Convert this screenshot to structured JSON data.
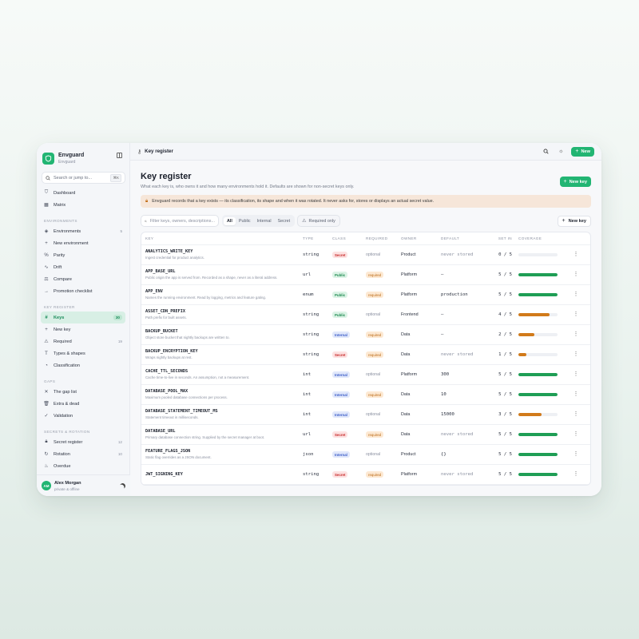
{
  "brand": {
    "name": "Envguard",
    "sub": "Envguard"
  },
  "search": {
    "placeholder": "Search or jump to...",
    "shortcut": "⌘K"
  },
  "sidebar": {
    "groups": [
      {
        "title": "",
        "items": [
          {
            "label": "Dashboard",
            "icon": "shield-icon"
          },
          {
            "label": "Matrix",
            "icon": "grid-icon"
          }
        ]
      },
      {
        "title": "ENVIRONMENTS",
        "items": [
          {
            "label": "Environments",
            "icon": "layers-icon",
            "count": "5"
          },
          {
            "label": "New environment",
            "icon": "plus-icon"
          },
          {
            "label": "Parity",
            "icon": "percent-icon"
          },
          {
            "label": "Drift",
            "icon": "activity-icon"
          },
          {
            "label": "Compare",
            "icon": "scale-icon"
          },
          {
            "label": "Promotion checklist",
            "icon": "arrow-right-icon"
          }
        ]
      },
      {
        "title": "KEY REGISTER",
        "items": [
          {
            "label": "Keys",
            "icon": "hash-icon",
            "count": "30",
            "active": true
          },
          {
            "label": "New key",
            "icon": "plus-icon"
          },
          {
            "label": "Required",
            "icon": "warning-icon",
            "count": "19"
          },
          {
            "label": "Types & shapes",
            "icon": "type-icon"
          },
          {
            "label": "Classification",
            "icon": "pie-icon"
          }
        ]
      },
      {
        "title": "GAPS",
        "items": [
          {
            "label": "The gap list",
            "icon": "x-icon"
          },
          {
            "label": "Extra & dead",
            "icon": "trash-icon"
          },
          {
            "label": "Validation",
            "icon": "check-icon"
          }
        ]
      },
      {
        "title": "SECRETS & ROTATION",
        "items": [
          {
            "label": "Secret register",
            "icon": "lock-icon",
            "count": "12"
          },
          {
            "label": "Rotation",
            "icon": "rotate-icon",
            "count": "10"
          },
          {
            "label": "Overdue",
            "icon": "flame-icon"
          }
        ]
      }
    ]
  },
  "user": {
    "initials": "AM",
    "name": "Alex Morgan",
    "sub": "private & offline"
  },
  "topbar": {
    "crumb": "Key register",
    "new_label": "New"
  },
  "page": {
    "title": "Key register",
    "subtitle": "What each key is, who owns it and how many environments hold it. Defaults are shown for non-secret keys only.",
    "new_key_label": "New key"
  },
  "banner": {
    "text": "Envguard records that a key exists — its classification, its shape and when it was rotated. It never asks for, stores or displays an actual secret value."
  },
  "filters": {
    "placeholder": "Filter keys, owners, descriptions...",
    "segments": [
      "All",
      "Public",
      "Internal",
      "Secret"
    ],
    "required_only": "Required only",
    "new_key": "New key"
  },
  "table": {
    "headers": [
      "KEY",
      "TYPE",
      "CLASS",
      "REQUIRED",
      "OWNER",
      "DEFAULT",
      "SET IN",
      "COVERAGE"
    ],
    "rows": [
      {
        "key": "ANALYTICS_WRITE_KEY",
        "desc": "Ingest credential for product analytics.",
        "type": "string",
        "class": "Secret",
        "required": "optional",
        "owner": "Product",
        "default": "never stored",
        "set": "0 / 5",
        "coverage": 0
      },
      {
        "key": "APP_BASE_URL",
        "desc": "Public origin the app is served from. Recorded as a shape, never as a literal address.",
        "type": "url",
        "class": "Public",
        "required": "required",
        "owner": "Platform",
        "default": "—",
        "set": "5 / 5",
        "coverage": 1
      },
      {
        "key": "APP_ENV",
        "desc": "Names the running environment. Read by logging, metrics and feature gating.",
        "type": "enum",
        "class": "Public",
        "required": "required",
        "owner": "Platform",
        "default": "production",
        "set": "5 / 5",
        "coverage": 1
      },
      {
        "key": "ASSET_CDN_PREFIX",
        "desc": "Path prefix for built assets.",
        "type": "string",
        "class": "Public",
        "required": "optional",
        "owner": "Frontend",
        "default": "—",
        "set": "4 / 5",
        "coverage": 0.8
      },
      {
        "key": "BACKUP_BUCKET",
        "desc": "Object store bucket that nightly backups are written to.",
        "type": "string",
        "class": "Internal",
        "required": "required",
        "owner": "Data",
        "default": "—",
        "set": "2 / 5",
        "coverage": 0.4
      },
      {
        "key": "BACKUP_ENCRYPTION_KEY",
        "desc": "Wraps nightly backups at rest.",
        "type": "string",
        "class": "Secret",
        "required": "required",
        "owner": "Data",
        "default": "never stored",
        "set": "1 / 5",
        "coverage": 0.2
      },
      {
        "key": "CACHE_TTL_SECONDS",
        "desc": "Cache time-to-live in seconds. An assumption, not a measurement.",
        "type": "int",
        "class": "Internal",
        "required": "optional",
        "owner": "Platform",
        "default": "300",
        "set": "5 / 5",
        "coverage": 1
      },
      {
        "key": "DATABASE_POOL_MAX",
        "desc": "Maximum pooled database connections per process.",
        "type": "int",
        "class": "Internal",
        "required": "required",
        "owner": "Data",
        "default": "10",
        "set": "5 / 5",
        "coverage": 1
      },
      {
        "key": "DATABASE_STATEMENT_TIMEOUT_MS",
        "desc": "Statement timeout in milliseconds.",
        "type": "int",
        "class": "Internal",
        "required": "optional",
        "owner": "Data",
        "default": "15000",
        "set": "3 / 5",
        "coverage": 0.6
      },
      {
        "key": "DATABASE_URL",
        "desc": "Primary database connection string. Supplied by the secret manager at boot.",
        "type": "url",
        "class": "Secret",
        "required": "required",
        "owner": "Data",
        "default": "never stored",
        "set": "5 / 5",
        "coverage": 1
      },
      {
        "key": "FEATURE_FLAGS_JSON",
        "desc": "Static flag overrides as a JSON document.",
        "type": "json",
        "class": "Internal",
        "required": "optional",
        "owner": "Product",
        "default": "{}",
        "set": "5 / 5",
        "coverage": 1
      },
      {
        "key": "JWT_SIGNING_KEY",
        "desc": "",
        "type": "string",
        "class": "Secret",
        "required": "required",
        "owner": "Platform",
        "default": "never stored",
        "set": "5 / 5",
        "coverage": 1
      }
    ]
  },
  "colors": {
    "accent": "#22b573",
    "full": "#1f9e55",
    "partial": "#d17a1a",
    "bg_track": "#eef0f4"
  }
}
